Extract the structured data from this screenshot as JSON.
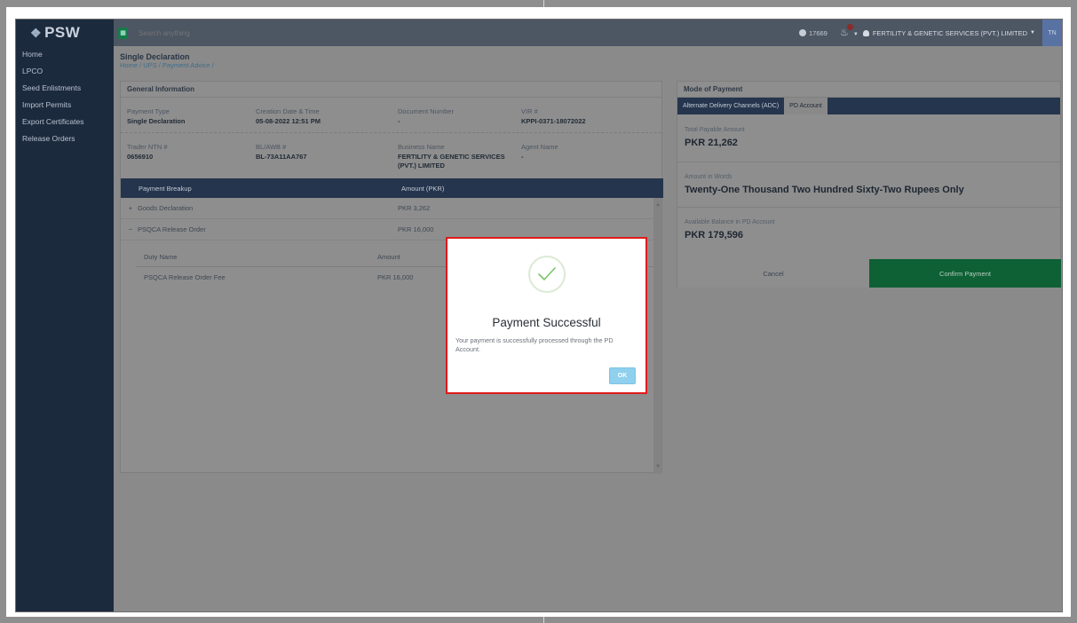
{
  "app": {
    "logo": "PSW",
    "logo_mark": "❖"
  },
  "sidebar": {
    "items": [
      {
        "label": "Home"
      },
      {
        "label": "LPCO"
      },
      {
        "label": "Seed Enlistments"
      },
      {
        "label": "Import Permits"
      },
      {
        "label": "Export Certificates"
      },
      {
        "label": "Release Orders"
      }
    ]
  },
  "topbar": {
    "search_placeholder": "Search anything",
    "counter": "17669",
    "company": "FERTILITY & GENETIC SERVICES (PVT.) LIMITED",
    "avatar_initials": "TN"
  },
  "page": {
    "title": "Single Declaration",
    "breadcrumb": "Home / UPS / Payment Advice /"
  },
  "general_info": {
    "heading": "General Information",
    "fields": [
      {
        "label": "Payment Type",
        "value": "Single Declaration"
      },
      {
        "label": "Creation Date & Time",
        "value": "05-08-2022 12:51 PM"
      },
      {
        "label": "Document Number",
        "value": "-"
      },
      {
        "label": "VIR #",
        "value": "KPPI-0371-18072022"
      },
      {
        "label": "Trader NTN #",
        "value": "0656910"
      },
      {
        "label": "BL/AWB #",
        "value": "BL-73A11AA767"
      },
      {
        "label": "Business Name",
        "value": "FERTILITY & GENETIC SERVICES (PVT.) LIMITED"
      },
      {
        "label": "Agent Name",
        "value": "-"
      }
    ]
  },
  "payment_breakup": {
    "col_breakup": "Payment Breakup",
    "col_amount": "Amount (PKR)",
    "rows": [
      {
        "sign": "+",
        "name": "Goods Declaration",
        "amount": "PKR 3,262"
      },
      {
        "sign": "−",
        "name": "PSQCA Release Order",
        "amount": "PKR 16,000"
      }
    ],
    "sub": {
      "col_duty": "Duty Name",
      "col_amount": "Amount",
      "rows": [
        {
          "name": "PSQCA Release Order Fee",
          "amount": "PKR 16,000"
        }
      ]
    }
  },
  "mode_of_payment": {
    "heading": "Mode of Payment",
    "tabs": [
      {
        "label": "Alternate Delivery Channels (ADC)"
      },
      {
        "label": "PD Account"
      }
    ],
    "total_label": "Total Payable Amount",
    "total_value": "PKR 21,262",
    "words_label": "Amount in Words",
    "words_value": "Twenty-One Thousand Two Hundred Sixty-Two Rupees Only",
    "balance_label": "Available Balance in PD Account",
    "balance_value": "PKR 179,596",
    "cancel_label": "Cancel",
    "confirm_label": "Confirm Payment"
  },
  "modal": {
    "title": "Payment Successful",
    "message": "Your payment is successfully processed through the PD Account.",
    "ok_label": "OK"
  },
  "colors": {
    "sidebar_bg": "#1c2a3e",
    "header_dark": "#25354d",
    "confirm_green": "#0e6035",
    "modal_border": "#e01b1b",
    "ok_button": "#8fd0ee",
    "check_green": "#7cc46a"
  }
}
